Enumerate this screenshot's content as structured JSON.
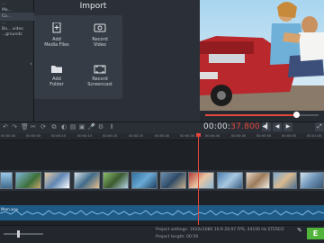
{
  "left_pane": {
    "items": [
      "...",
      "Ma...",
      "Co...",
      "...",
      "Ba... video",
      "...grounds"
    ]
  },
  "import": {
    "title": "Import",
    "tiles": [
      {
        "label_line1": "Add",
        "label_line2": "Media Files",
        "icon": "plus-file-icon"
      },
      {
        "label_line1": "Record",
        "label_line2": "Video",
        "icon": "camera-icon"
      },
      {
        "label_line1": "Add",
        "label_line2": "Folder",
        "icon": "folder-icon"
      },
      {
        "label_line1": "Record",
        "label_line2": "Screencast",
        "icon": "screen-icon"
      }
    ]
  },
  "player": {
    "timecode_main": "00:00:",
    "timecode_ms": "37.800",
    "progress": 0.8,
    "controls": [
      "◀▎",
      "◀",
      "▶"
    ]
  },
  "ruler": {
    "ticks": [
      "00:00:00",
      "00:00:05",
      "00:00:10",
      "00:00:15",
      "00:00:20",
      "00:00:25",
      "00:00:30",
      "00:00:35",
      "00:00:40",
      "00:00:45",
      "00:00:50",
      "00:00:55",
      "00:01:00"
    ]
  },
  "audio": {
    "label": "Mem.wav"
  },
  "footer": {
    "settings_label": "Project settings:",
    "settings_value": "1920x1080 16:9 29.97 FPS, 44100 Hz STEREO",
    "length_label": "Project length:",
    "length_value": "00:59",
    "export_label": "E"
  },
  "colors": {
    "accent": "#e3463b",
    "export": "#53b43c",
    "audio": "#1e5a86"
  }
}
